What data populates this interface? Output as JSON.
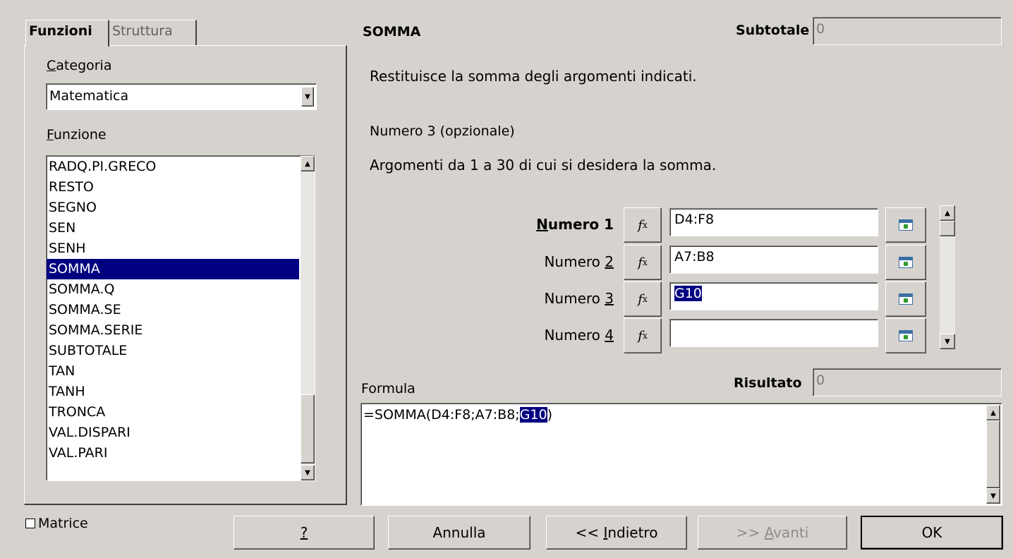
{
  "tabs": [
    "Funzioni",
    "Struttura"
  ],
  "category": {
    "label": "Categoria",
    "value": "Matematica"
  },
  "function_list": {
    "label": "Funzione",
    "items": [
      "RADQ.PI.GRECO",
      "RESTO",
      "SEGNO",
      "SEN",
      "SENH",
      "SOMMA",
      "SOMMA.Q",
      "SOMMA.SE",
      "SOMMA.SERIE",
      "SUBTOTALE",
      "TAN",
      "TANH",
      "TRONCA",
      "VAL.DISPARI",
      "VAL.PARI"
    ],
    "selected": "SOMMA"
  },
  "function_name": "SOMMA",
  "subtotal": {
    "label": "Subtotale",
    "value": "0"
  },
  "description": "Restituisce la somma degli argomenti indicati.",
  "argument_title": "Numero 3 (opzionale)",
  "argument_description": "Argomenti da 1 a 30 di cui si desidera la somma.",
  "arguments": [
    {
      "label": "Numero 1",
      "value": "D4:F8",
      "bold": true
    },
    {
      "label": "Numero 2",
      "value": "A7:B8",
      "bold": false
    },
    {
      "label": "Numero 3",
      "value": "G10",
      "bold": false,
      "selected": true
    },
    {
      "label": "Numero 4",
      "value": "",
      "bold": false
    }
  ],
  "fx_label": "fx",
  "formula": {
    "label": "Formula",
    "prefix": "=SOMMA(D4:F8;A7:B8;",
    "highlight": "G10",
    "suffix": ")"
  },
  "result": {
    "label": "Risultato",
    "value": "0"
  },
  "matrix": {
    "label": "Matrice",
    "checked": false
  },
  "buttons": {
    "help": "?",
    "cancel": "Annulla",
    "back": "<< Indietro",
    "next": ">> Avanti",
    "ok": "OK"
  },
  "colors": {
    "selection": "#000080",
    "dialog_bg": "#d6d3ce"
  }
}
